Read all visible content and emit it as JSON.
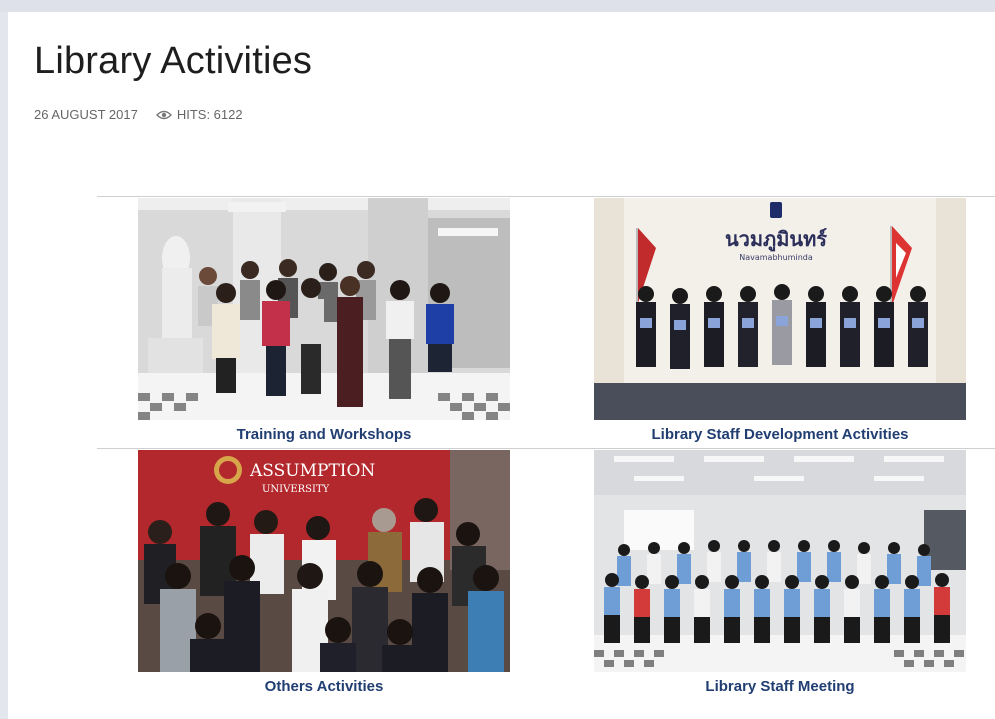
{
  "article": {
    "title": "Library Activities",
    "date": "26 AUGUST 2017",
    "hits_label": "HITS: 6122"
  },
  "gallery": [
    {
      "caption": "Training and Workshops"
    },
    {
      "caption": "Library  Staff Development Activities"
    },
    {
      "caption": "Others Activities"
    },
    {
      "caption": "Library  Staff Meeting"
    }
  ],
  "photo_text": {
    "thai_sign": "นวมภูมินทร์",
    "thai_sign_sub": "Navamabhuminda",
    "banner_line1": "ASSUMPTION",
    "banner_line2": "UNIVERSITY"
  },
  "colors": {
    "caption": "#213e72",
    "title": "#1e1e1e",
    "meta": "#666666",
    "banner_red": "#b3282d"
  },
  "icons": {
    "hits": "eye-icon"
  }
}
